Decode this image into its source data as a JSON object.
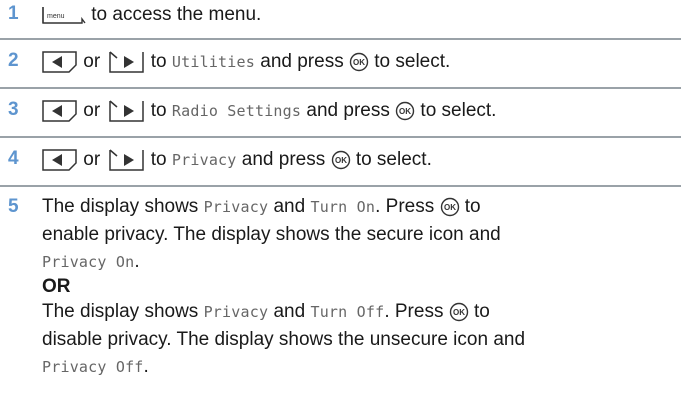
{
  "steps": [
    {
      "number": "1",
      "menu_key_text": "menu",
      "text": "to access the menu."
    },
    {
      "number": "2",
      "or": "or",
      "to": "to",
      "target": "Utilities",
      "and_press": "and press",
      "to_select": "to select."
    },
    {
      "number": "3",
      "or": "or",
      "to": "to",
      "target": "Radio Settings",
      "and_press": "and press",
      "to_select": "to select."
    },
    {
      "number": "4",
      "or": "or",
      "to": "to",
      "target": "Privacy",
      "and_press": "and press",
      "to_select": "to select."
    },
    {
      "number": "5",
      "a": {
        "display_shows": "The display shows",
        "item1": "Privacy",
        "and": "and",
        "item2": "Turn On",
        "press": ". Press",
        "to": "to",
        "line2": "enable privacy. The display shows the secure icon and",
        "final": "Privacy On",
        "period": "."
      },
      "or_label": "OR",
      "b": {
        "display_shows": "The display shows",
        "item1": "Privacy",
        "and": "and",
        "item2": "Turn Off",
        "press": ". Press",
        "to": "to",
        "line2": "disable privacy. The display shows the unsecure icon and",
        "final": "Privacy Off",
        "period": "."
      }
    }
  ],
  "ok_key_text": "OK",
  "colors": {
    "step_number": "#5e95cf",
    "rule": "#9aa2a8",
    "mono_text": "#666666"
  },
  "icons": [
    "menu-key-icon",
    "left-arrow-key-icon",
    "right-arrow-key-icon",
    "ok-key-icon"
  ]
}
